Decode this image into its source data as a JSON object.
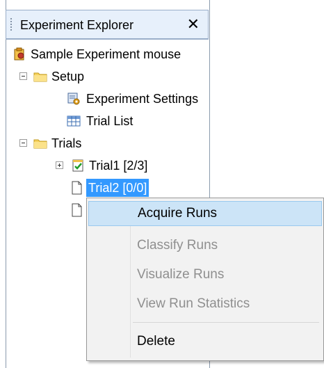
{
  "panel": {
    "title": "Experiment Explorer",
    "close_glyph": "✕"
  },
  "tree": {
    "root": {
      "label": "Sample Experiment mouse",
      "icon": "experiment-icon"
    },
    "setup": {
      "label": "Setup",
      "icon": "folder-icon",
      "expanded": true
    },
    "settings": {
      "label": "Experiment Settings",
      "icon": "settings-icon"
    },
    "trial_list": {
      "label": "Trial List",
      "icon": "table-icon"
    },
    "trials": {
      "label": "Trials",
      "icon": "folder-icon",
      "expanded": true
    },
    "trial1": {
      "label": "Trial1 [2/3]",
      "icon": "checked-doc-icon",
      "expanded": false
    },
    "trial2": {
      "label": "Trial2 [0/0]",
      "icon": "document-icon",
      "selected": true
    }
  },
  "context_menu": {
    "items": [
      {
        "label": "Acquire Runs",
        "enabled": true,
        "highlighted": true
      },
      {
        "label": "Classify Runs",
        "enabled": false
      },
      {
        "label": "Visualize Runs",
        "enabled": false
      },
      {
        "label": "View Run Statistics",
        "enabled": false
      },
      {
        "label": "Delete",
        "enabled": true
      }
    ]
  },
  "colors": {
    "selection": "#3399ff",
    "menu_highlight": "#cce4f7",
    "disabled_text": "#8f8f8f"
  }
}
